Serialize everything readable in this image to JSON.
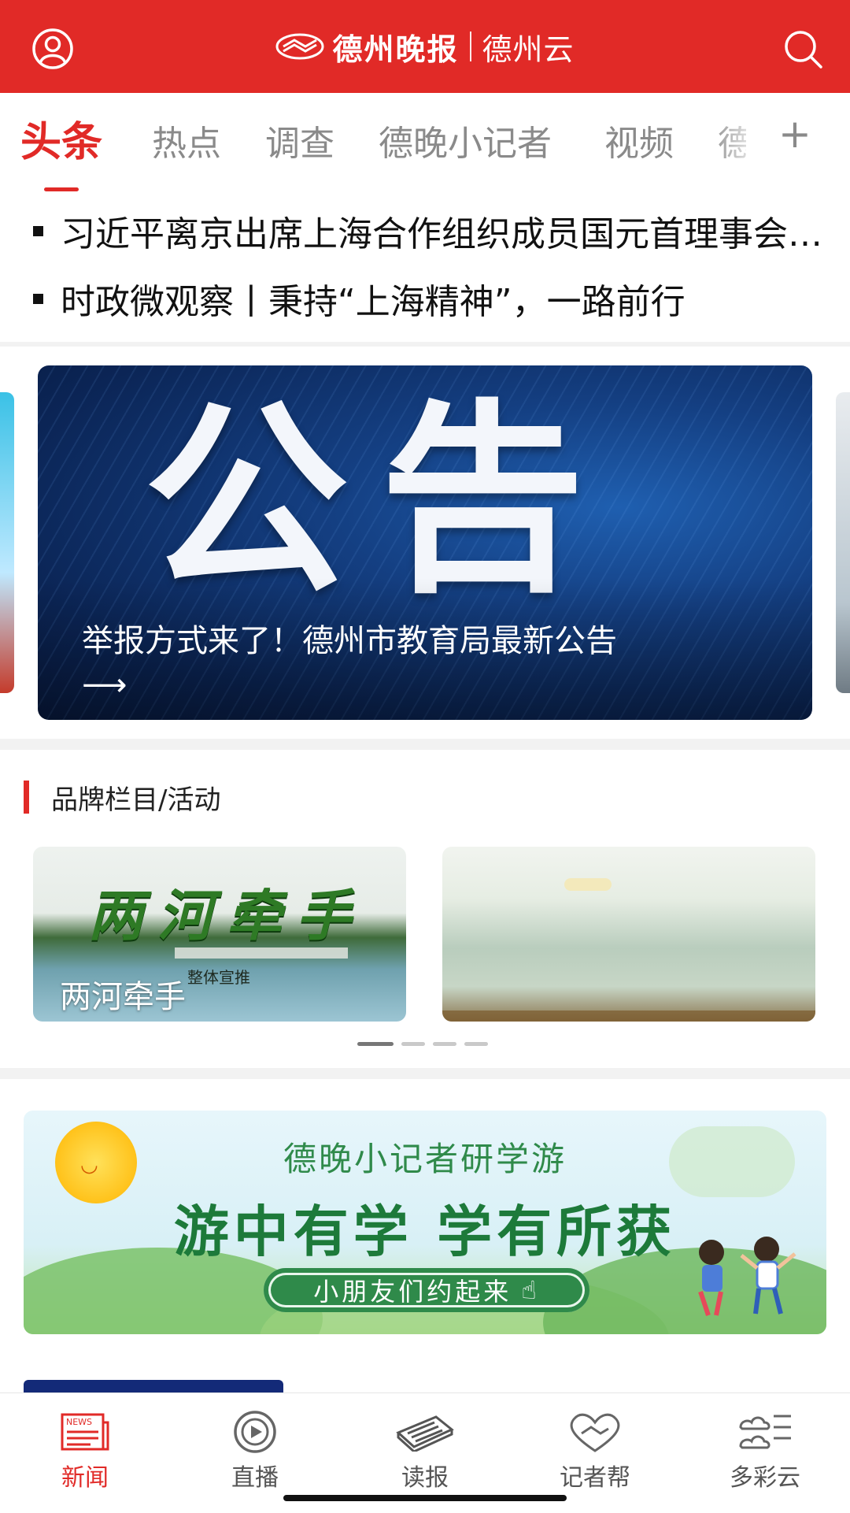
{
  "header": {
    "paper_name": "德州晚报",
    "cloud_name": "德州云",
    "brand_color": "#e12a27"
  },
  "tabs": {
    "items": [
      "头条",
      "热点",
      "调查",
      "德晚小记者",
      "视频",
      "德"
    ],
    "active_index": 0,
    "add_symbol": "+"
  },
  "headlines": [
    {
      "text": "习近平离京出席上海合作组织成员国元首理事会第二十五次会议"
    },
    {
      "text": "时政微观察丨秉持“上海精神”，一路前行"
    }
  ],
  "carousel": {
    "big_text": "公告",
    "caption": "举报方式来了！德州市教育局最新公告",
    "arrow": "⟶"
  },
  "brand_section": {
    "title": "品牌栏目/活动",
    "cards": [
      {
        "art_title": "两河牵手",
        "sub": "整体宣推",
        "name": "两河牵手"
      },
      {
        "art_title": "",
        "sub": "",
        "name": ""
      }
    ],
    "page_count": 4,
    "active_page": 0
  },
  "banner": {
    "line1": "德晚小记者研学游",
    "line2": "游中有学  学有所获",
    "cta": "小朋友们约起来"
  },
  "bottom_nav": {
    "items": [
      {
        "label": "新闻",
        "icon": "news-icon"
      },
      {
        "label": "直播",
        "icon": "live-play-icon"
      },
      {
        "label": "读报",
        "icon": "newspaper-icon"
      },
      {
        "label": "记者帮",
        "icon": "handshake-heart-icon"
      },
      {
        "label": "多彩云",
        "icon": "cloud-list-icon"
      }
    ],
    "active_index": 0
  }
}
